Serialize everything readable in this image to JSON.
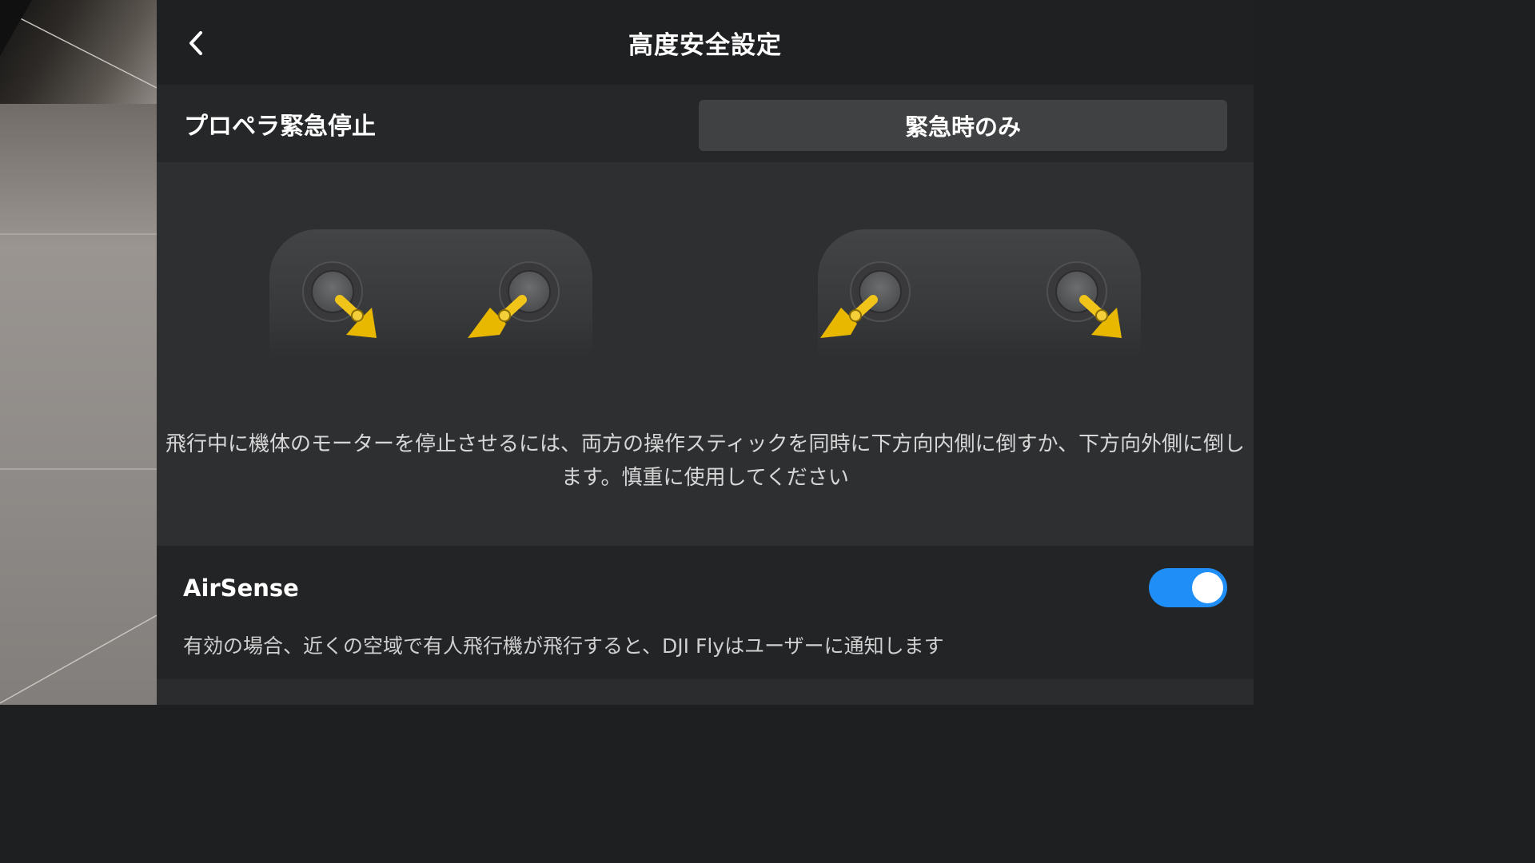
{
  "header": {
    "title": "高度安全設定",
    "back_icon": "chevron-left-icon"
  },
  "propeller_stop": {
    "label": "プロペラ緊急停止",
    "selected_mode": "緊急時のみ"
  },
  "illustration": {
    "description": "飛行中に機体のモーターを停止させるには、両方の操作スティックを同時に下方向内側に倒すか、下方向外側に倒します。慎重に使用してください",
    "arrow_color": "#f0c419",
    "stick_color": "#5a5b5d"
  },
  "airsense": {
    "title": "AirSense",
    "enabled": true,
    "description": "有効の場合、近くの空域で有人飛行機が飛行すると、DJI Flyはユーザーに通知します",
    "toggle_color": "#1f8ef7"
  }
}
